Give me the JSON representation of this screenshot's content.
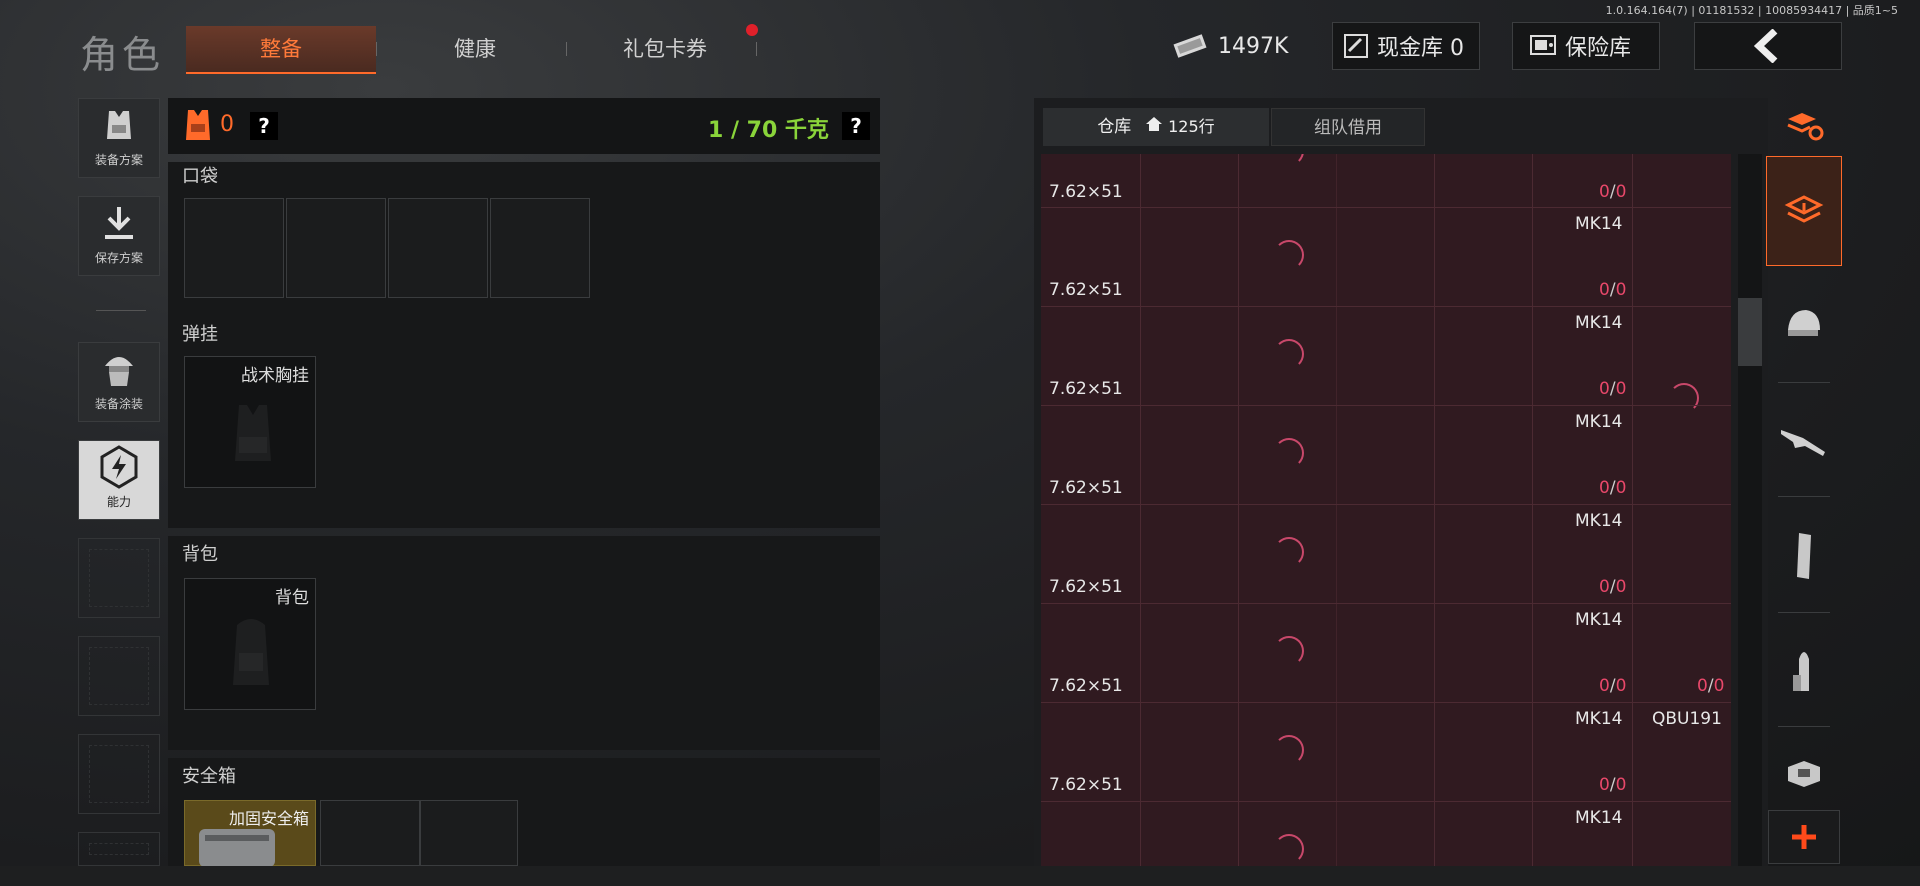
{
  "version": "1.0.164.164(7) | 01181532 | 10085934417 | 品质1~5",
  "page_title": "角色",
  "tabs": [
    {
      "label": "整备",
      "active": true
    },
    {
      "label": "健康",
      "active": false
    },
    {
      "label": "礼包卡券",
      "active": false,
      "badge": true
    }
  ],
  "header": {
    "currency": "1497K",
    "cash_vault": "现金库 0",
    "safe_vault": "保险库"
  },
  "left_nav": [
    {
      "label": "装备方案",
      "icon": "vest-icon"
    },
    {
      "label": "保存方案",
      "icon": "download-icon"
    },
    {
      "label": "装备涂装",
      "icon": "helmet-soldier-icon"
    },
    {
      "label": "能力",
      "icon": "ability-icon",
      "active": true
    }
  ],
  "loadout": {
    "armor_count": "0",
    "help": "?",
    "weight": "1 / 70 千克",
    "pocket_title": "口袋",
    "rig_title": "弹挂",
    "rig_item": "战术胸挂",
    "backpack_title": "背包",
    "backpack_item": "背包",
    "safebox_title": "安全箱",
    "safebox_item": "加固安全箱"
  },
  "warehouse": {
    "tab_storage": "仓库",
    "tab_storage_rows": "125行",
    "tab_team": "组队借用",
    "rows": [
      {
        "caliber": "7.62×51",
        "count_a": "0",
        "count_b": "0",
        "weapon": "MK14"
      },
      {
        "caliber": "7.62×51",
        "count_a": "0",
        "count_b": "0",
        "weapon": "MK14"
      },
      {
        "caliber": "7.62×51",
        "count_a": "0",
        "count_b": "0",
        "weapon": "MK14"
      },
      {
        "caliber": "7.62×51",
        "count_a": "0",
        "count_b": "0",
        "weapon": "MK14"
      },
      {
        "caliber": "7.62×51",
        "count_a": "0",
        "count_b": "0",
        "weapon": "MK14"
      },
      {
        "caliber": "7.62×51",
        "count_a": "0",
        "count_b": "0",
        "weapon": "MK14"
      },
      {
        "caliber": "7.62×51",
        "count_a": "0",
        "count_b": "0",
        "weapon": "MK14"
      }
    ],
    "row0_caliber": "7.62×51",
    "row0_a": "0",
    "row0_b": "0",
    "extra_count_a": "0",
    "extra_count_b": "0",
    "extra_weapon": "QBU191"
  },
  "colors": {
    "accent": "#ff6a2a",
    "weight_green": "#8ad43a",
    "grid_bg": "#301a20",
    "count_red": "#e8486a"
  }
}
